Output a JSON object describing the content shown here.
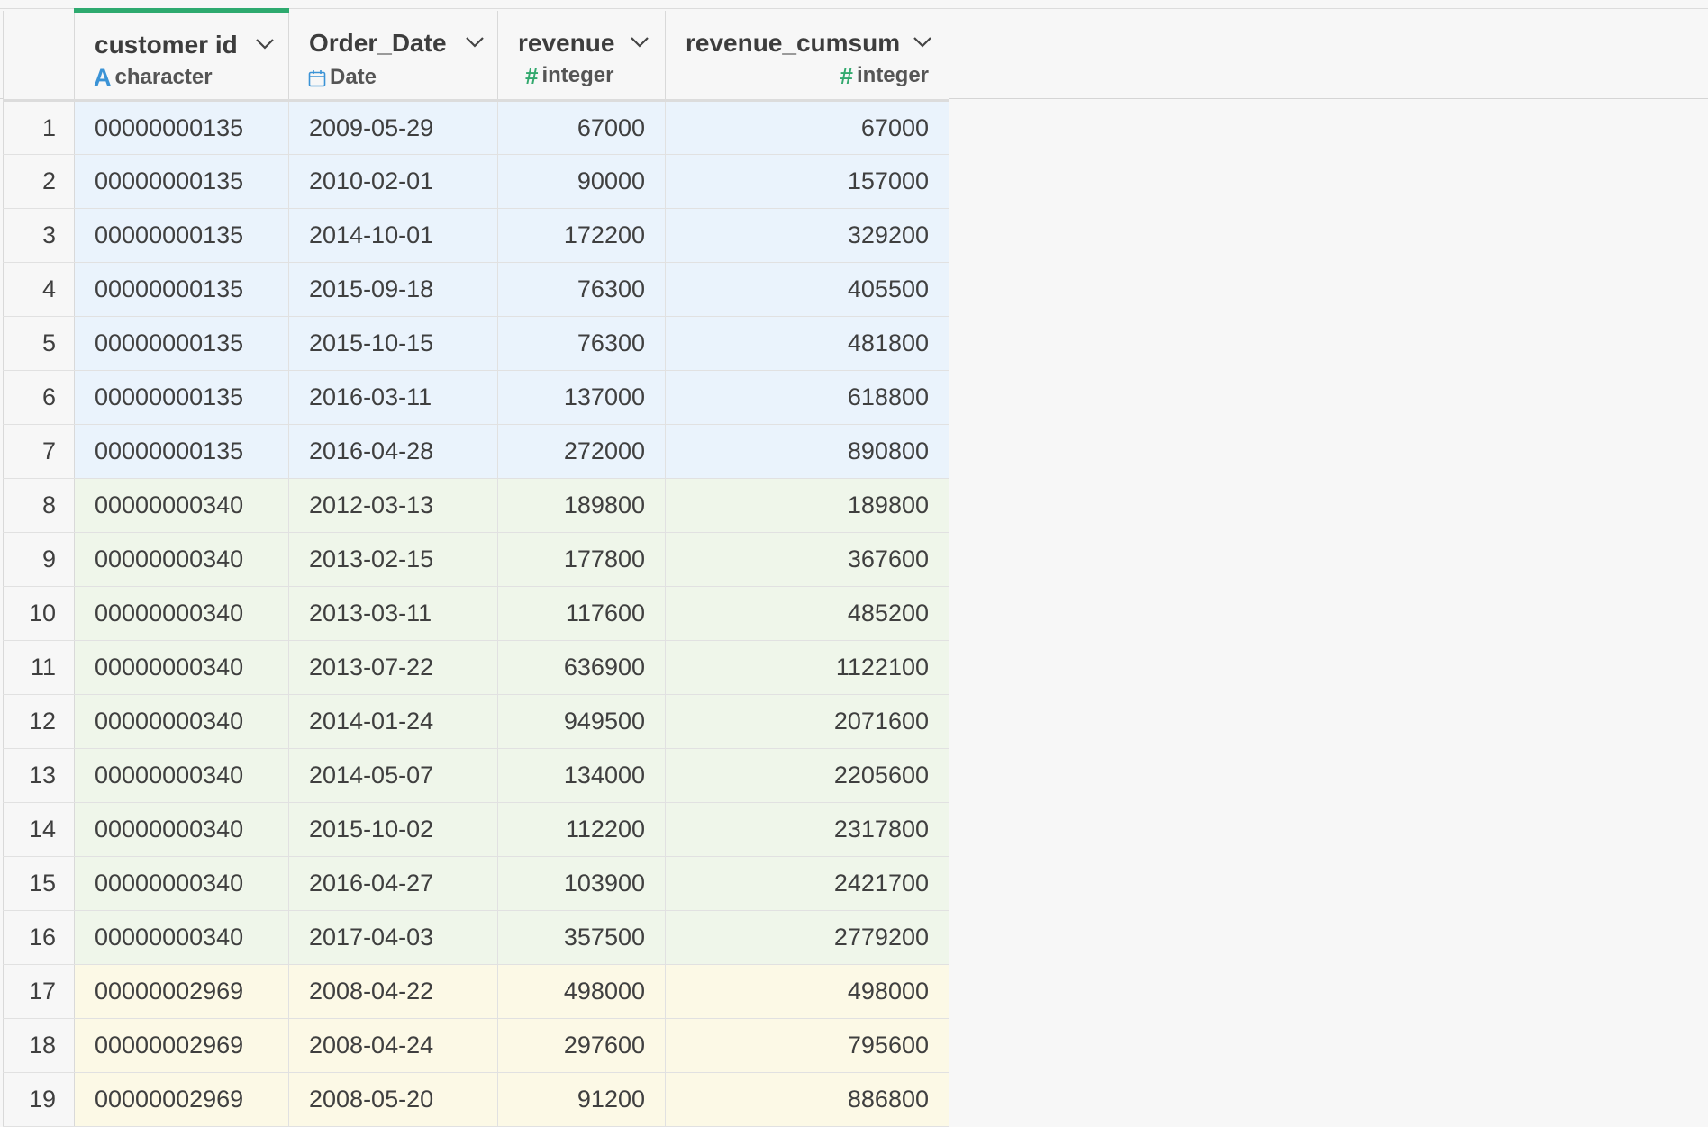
{
  "columns": [
    {
      "name": "customer id",
      "type_icon": "A",
      "type": "character"
    },
    {
      "name": "Order_Date",
      "type_icon": "calendar-icon",
      "type": "Date"
    },
    {
      "name": "revenue",
      "type_icon": "#",
      "type": "integer"
    },
    {
      "name": "revenue_cumsum",
      "type_icon": "#",
      "type": "integer"
    }
  ],
  "group_colors": {
    "g1": "#eaf3fc",
    "g2": "#eff6ea",
    "g3": "#fcf9e6"
  },
  "rows": [
    {
      "n": "1",
      "customer_id": "00000000135",
      "order_date": "2009-05-29",
      "revenue": "67000",
      "revenue_cumsum": "67000",
      "group": "g1"
    },
    {
      "n": "2",
      "customer_id": "00000000135",
      "order_date": "2010-02-01",
      "revenue": "90000",
      "revenue_cumsum": "157000",
      "group": "g1"
    },
    {
      "n": "3",
      "customer_id": "00000000135",
      "order_date": "2014-10-01",
      "revenue": "172200",
      "revenue_cumsum": "329200",
      "group": "g1"
    },
    {
      "n": "4",
      "customer_id": "00000000135",
      "order_date": "2015-09-18",
      "revenue": "76300",
      "revenue_cumsum": "405500",
      "group": "g1"
    },
    {
      "n": "5",
      "customer_id": "00000000135",
      "order_date": "2015-10-15",
      "revenue": "76300",
      "revenue_cumsum": "481800",
      "group": "g1"
    },
    {
      "n": "6",
      "customer_id": "00000000135",
      "order_date": "2016-03-11",
      "revenue": "137000",
      "revenue_cumsum": "618800",
      "group": "g1"
    },
    {
      "n": "7",
      "customer_id": "00000000135",
      "order_date": "2016-04-28",
      "revenue": "272000",
      "revenue_cumsum": "890800",
      "group": "g1"
    },
    {
      "n": "8",
      "customer_id": "00000000340",
      "order_date": "2012-03-13",
      "revenue": "189800",
      "revenue_cumsum": "189800",
      "group": "g2"
    },
    {
      "n": "9",
      "customer_id": "00000000340",
      "order_date": "2013-02-15",
      "revenue": "177800",
      "revenue_cumsum": "367600",
      "group": "g2"
    },
    {
      "n": "10",
      "customer_id": "00000000340",
      "order_date": "2013-03-11",
      "revenue": "117600",
      "revenue_cumsum": "485200",
      "group": "g2"
    },
    {
      "n": "11",
      "customer_id": "00000000340",
      "order_date": "2013-07-22",
      "revenue": "636900",
      "revenue_cumsum": "1122100",
      "group": "g2"
    },
    {
      "n": "12",
      "customer_id": "00000000340",
      "order_date": "2014-01-24",
      "revenue": "949500",
      "revenue_cumsum": "2071600",
      "group": "g2"
    },
    {
      "n": "13",
      "customer_id": "00000000340",
      "order_date": "2014-05-07",
      "revenue": "134000",
      "revenue_cumsum": "2205600",
      "group": "g2"
    },
    {
      "n": "14",
      "customer_id": "00000000340",
      "order_date": "2015-10-02",
      "revenue": "112200",
      "revenue_cumsum": "2317800",
      "group": "g2"
    },
    {
      "n": "15",
      "customer_id": "00000000340",
      "order_date": "2016-04-27",
      "revenue": "103900",
      "revenue_cumsum": "2421700",
      "group": "g2"
    },
    {
      "n": "16",
      "customer_id": "00000000340",
      "order_date": "2017-04-03",
      "revenue": "357500",
      "revenue_cumsum": "2779200",
      "group": "g2"
    },
    {
      "n": "17",
      "customer_id": "00000002969",
      "order_date": "2008-04-22",
      "revenue": "498000",
      "revenue_cumsum": "498000",
      "group": "g3"
    },
    {
      "n": "18",
      "customer_id": "00000002969",
      "order_date": "2008-04-24",
      "revenue": "297600",
      "revenue_cumsum": "795600",
      "group": "g3"
    },
    {
      "n": "19",
      "customer_id": "00000002969",
      "order_date": "2008-05-20",
      "revenue": "91200",
      "revenue_cumsum": "886800",
      "group": "g3"
    }
  ]
}
